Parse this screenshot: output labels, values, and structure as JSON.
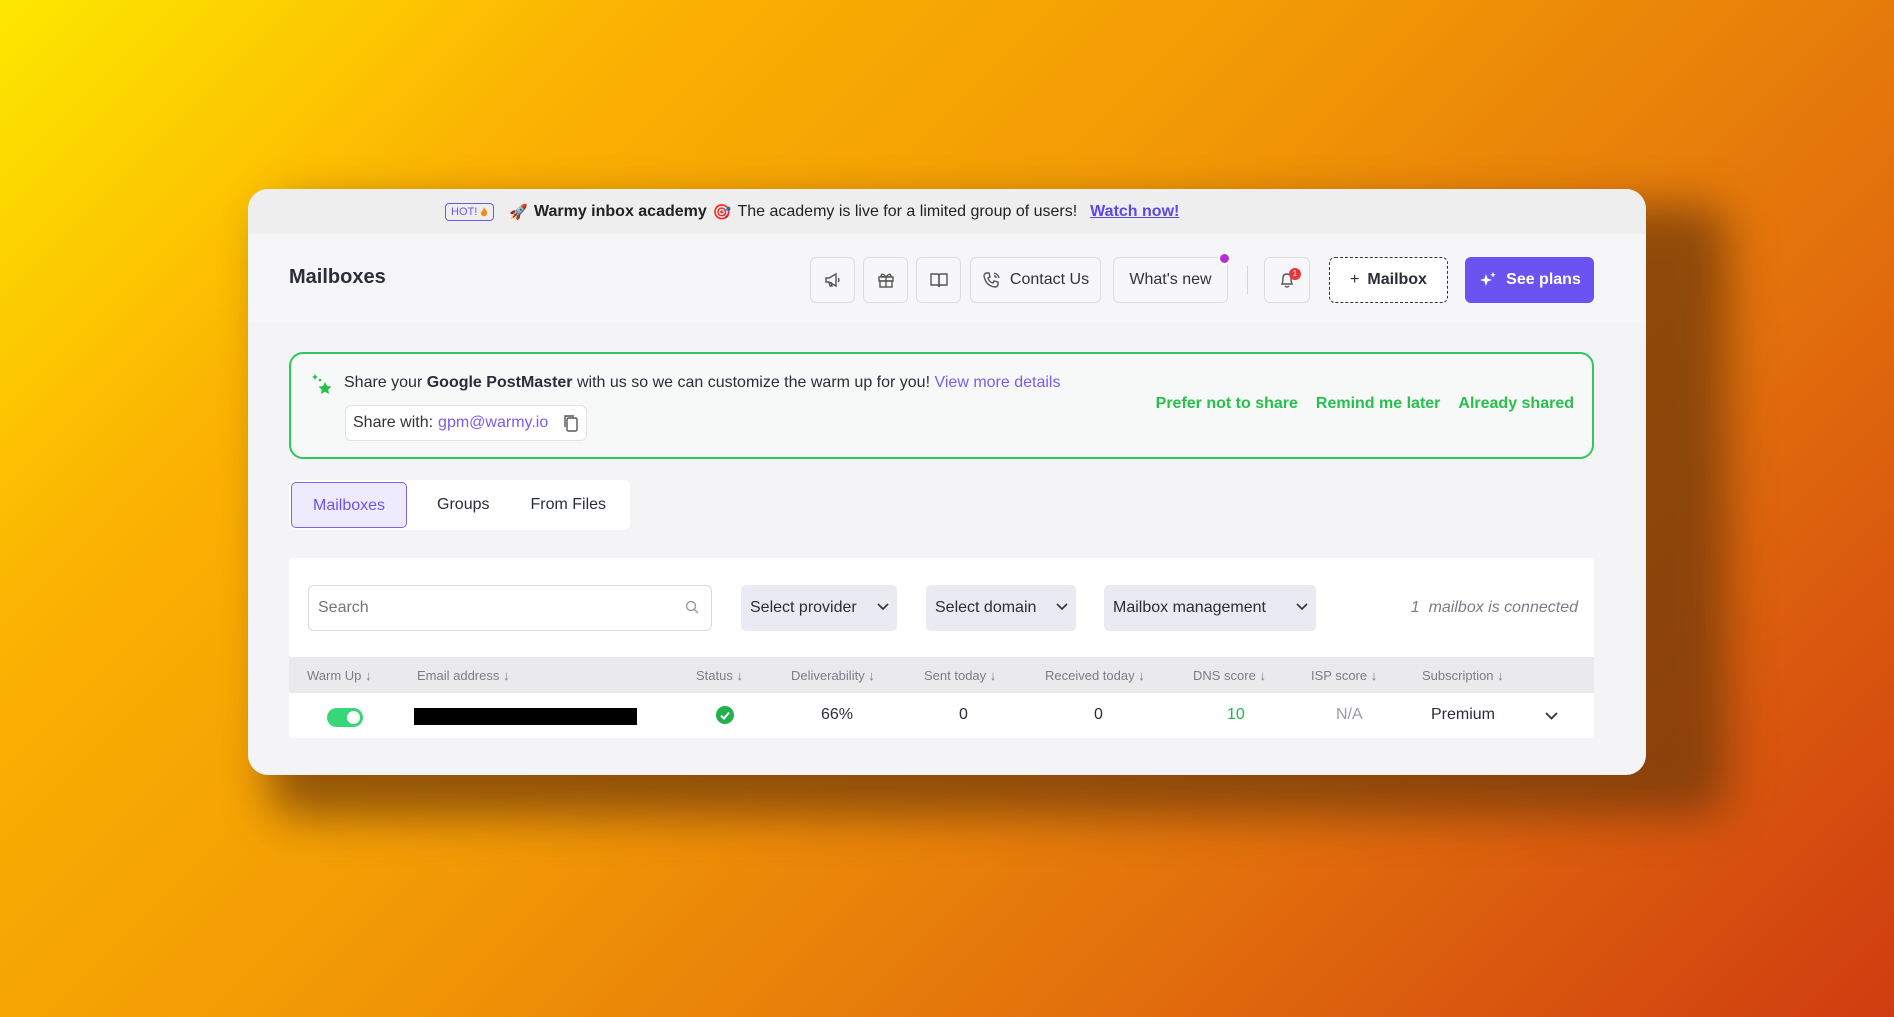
{
  "promo": {
    "badge": "HOT!",
    "rocket": "🚀",
    "title": "Warmy inbox academy",
    "target": "🎯",
    "description": "The academy is live for a limited group of users!",
    "link": "Watch now!"
  },
  "header": {
    "title": "Mailboxes",
    "contact_label": "Contact Us",
    "whats_new_label": "What's new",
    "bell_count": "1",
    "add_mailbox_label": "Mailbox",
    "see_plans_label": "See plans"
  },
  "postmaster": {
    "text_before": "Share your",
    "text_bold": "Google PostMaster",
    "text_after": "with us so we can customize the warm up for you!",
    "details_link": "View more details",
    "share_label": "Share with:",
    "share_email": "gpm@warmy.io",
    "actions": [
      "Prefer not to share",
      "Remind me later",
      "Already shared"
    ]
  },
  "tabs": [
    "Mailboxes",
    "Groups",
    "From Files"
  ],
  "filters": {
    "search_placeholder": "Search",
    "provider": "Select provider",
    "domain": "Select domain",
    "management": "Mailbox management",
    "connected_count": "1",
    "connected_text": "mailbox is connected"
  },
  "table": {
    "columns": [
      "Warm Up ↓",
      "Email address ↓",
      "Status ↓",
      "Deliverability ↓",
      "Sent today ↓",
      "Received today ↓",
      "DNS score ↓",
      "ISP score ↓",
      "Subscription ↓"
    ],
    "rows": [
      {
        "warm_up": true,
        "email": "",
        "status": "ok",
        "deliverability": "66%",
        "sent_today": "0",
        "received_today": "0",
        "dns_score": "10",
        "isp_score": "N/A",
        "subscription": "Premium"
      }
    ]
  },
  "colors": {
    "accent": "#6b53f2",
    "success": "#2fc85a",
    "toggle_on": "#38d67a"
  }
}
